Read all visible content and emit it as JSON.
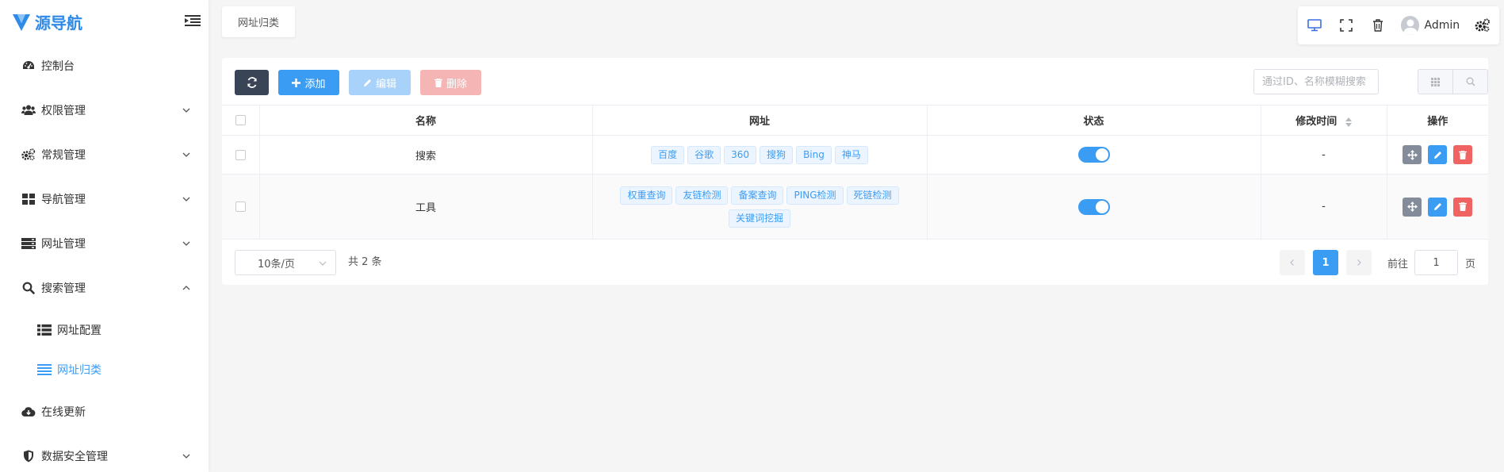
{
  "app": {
    "logo_text": "源导航"
  },
  "sidebar": {
    "items": [
      {
        "label": "控制台"
      },
      {
        "label": "权限管理"
      },
      {
        "label": "常规管理"
      },
      {
        "label": "导航管理"
      },
      {
        "label": "网址管理"
      },
      {
        "label": "搜索管理"
      },
      {
        "label": "在线更新"
      },
      {
        "label": "数据安全管理"
      }
    ],
    "sub_items": [
      {
        "label": "网址配置"
      },
      {
        "label": "网址归类"
      }
    ]
  },
  "breadcrumb": {
    "tab": "网址归类"
  },
  "topbar": {
    "user": "Admin"
  },
  "toolbar": {
    "add": "添加",
    "edit": "编辑",
    "delete": "删除",
    "search_placeholder": "通过ID、名称模糊搜索"
  },
  "table": {
    "headers": [
      "名称",
      "网址",
      "状态",
      "修改时间",
      "操作"
    ],
    "rows": [
      {
        "name": "搜索",
        "tags": [
          "百度",
          "谷歌",
          "360",
          "搜狗",
          "Bing",
          "神马"
        ],
        "status": true,
        "modified": "-"
      },
      {
        "name": "工具",
        "tags": [
          "权重查询",
          "友链检测",
          "备案查询",
          "PING检测",
          "死链检测",
          "关键词挖掘"
        ],
        "status": true,
        "modified": "-"
      }
    ]
  },
  "pagination": {
    "page_size": "10条/页",
    "total": "共 2 条",
    "current": "1",
    "goto_label": "前往",
    "goto_value": "1",
    "page_label": "页"
  },
  "colors": {
    "primary": "#3b9cf4",
    "dark": "#3a4457",
    "danger": "#ef6363"
  }
}
